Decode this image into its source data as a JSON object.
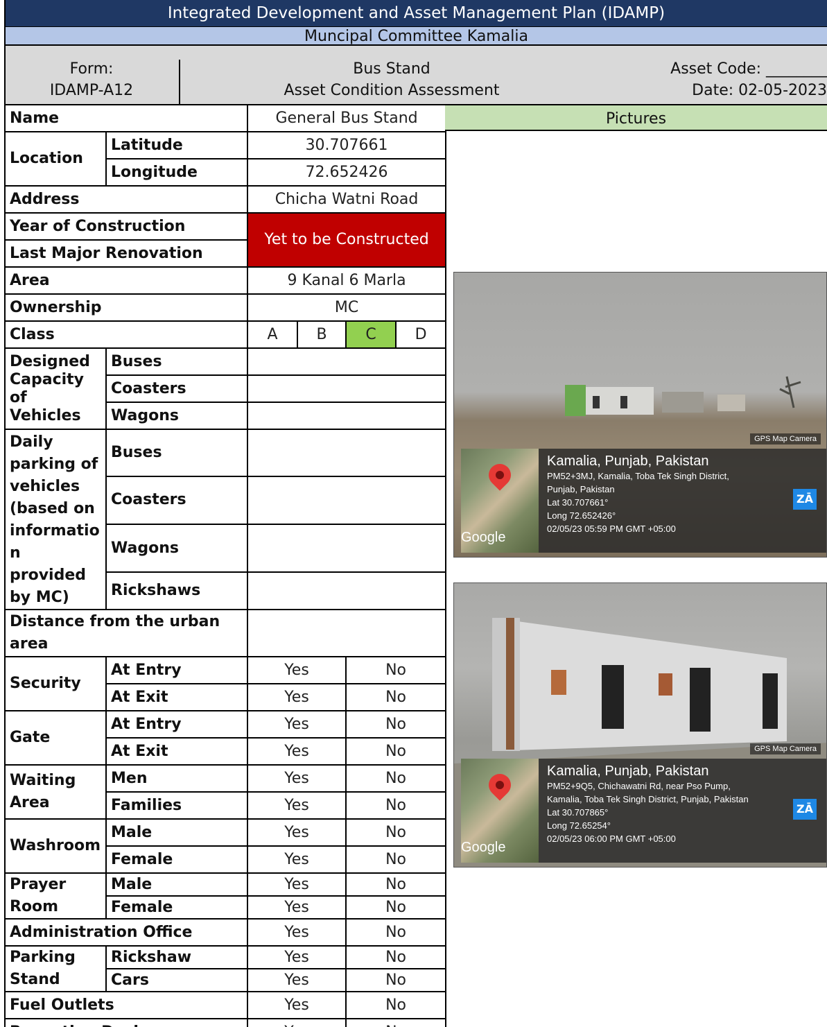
{
  "header": {
    "title": "Integrated Development and Asset Management Plan (IDAMP)",
    "subtitle": "Muncipal Committee Kamalia",
    "form_label": "Form:",
    "form_code": "IDAMP-A12",
    "asset_type": "Bus Stand",
    "assessment": "Asset Condition Assessment",
    "asset_code": "Asset Code: ________",
    "date": "Date: 02-05-2023"
  },
  "form": {
    "name_label": "Name",
    "name_value": "General Bus Stand",
    "location_label": "Location",
    "latitude_label": "Latitude",
    "latitude_value": "30.707661",
    "longitude_label": "Longitude",
    "longitude_value": "72.652426",
    "address_label": "Address",
    "address_value": "Chicha Watni Road",
    "year_label": "Year of Construction",
    "renovation_label": "Last Major Renovation",
    "construction_value": "Yet to be Constructed",
    "area_label": "Area",
    "area_value": "9 Kanal 6 Marla",
    "ownership_label": "Ownership",
    "ownership_value": "MC",
    "class_label": "Class",
    "class_options": [
      "A",
      "B",
      "C",
      "D"
    ],
    "designed_label": "Designed Capacity of Vehicles",
    "daily_label": "Daily parking of vehicles (based on informatio n provided by MC)",
    "buses": "Buses",
    "coasters": "Coasters",
    "wagons": "Wagons",
    "rickshaws": "Rickshaws",
    "distance_label": "Distance from the urban area",
    "security_label": "Security",
    "gate_label": "Gate",
    "at_entry": "At Entry",
    "at_exit": "At Exit",
    "waiting_label": "Waiting Area",
    "men": "Men",
    "families": "Families",
    "washroom_label": "Washroom",
    "prayer_label": "Prayer Room",
    "male": "Male",
    "female": "Female",
    "admin_label": "Administration Office",
    "parking_label": "Parking Stand",
    "rickshaw": "Rickshaw",
    "cars": "Cars",
    "fuel_label": "Fuel Outlets",
    "reception_label": "Reception Desk",
    "yes": "Yes",
    "no": "No"
  },
  "pictures": {
    "header": "Pictures",
    "photo1": {
      "badge": "GPS Map Camera",
      "city": "Kamalia, Punjab, Pakistan",
      "line1": "PM52+3MJ, Kamalia, Toba Tek Singh District,",
      "line2": "Punjab, Pakistan",
      "lat": "Lat 30.707661°",
      "long": "Long 72.652426°",
      "time": "02/05/23 05:59 PM GMT +05:00",
      "google": "Google"
    },
    "photo2": {
      "badge": "GPS Map Camera",
      "city": "Kamalia, Punjab, Pakistan",
      "line1": "PM52+9Q5, Chichawatni Rd, near Pso Pump,",
      "line2": "Kamalia, Toba Tek Singh District, Punjab, Pakistan",
      "lat": "Lat 30.707865°",
      "long": "Long 72.65254°",
      "time": "02/05/23 06:00 PM GMT +05:00",
      "google": "Google"
    }
  },
  "colors": {
    "title_bg": "#1f3864",
    "subtitle_bg": "#b4c6e7",
    "header_bg": "#d9d9d9",
    "pictures_bg": "#c6e0b4",
    "construction_bg": "#c00000",
    "selected_class_bg": "#92d050"
  }
}
